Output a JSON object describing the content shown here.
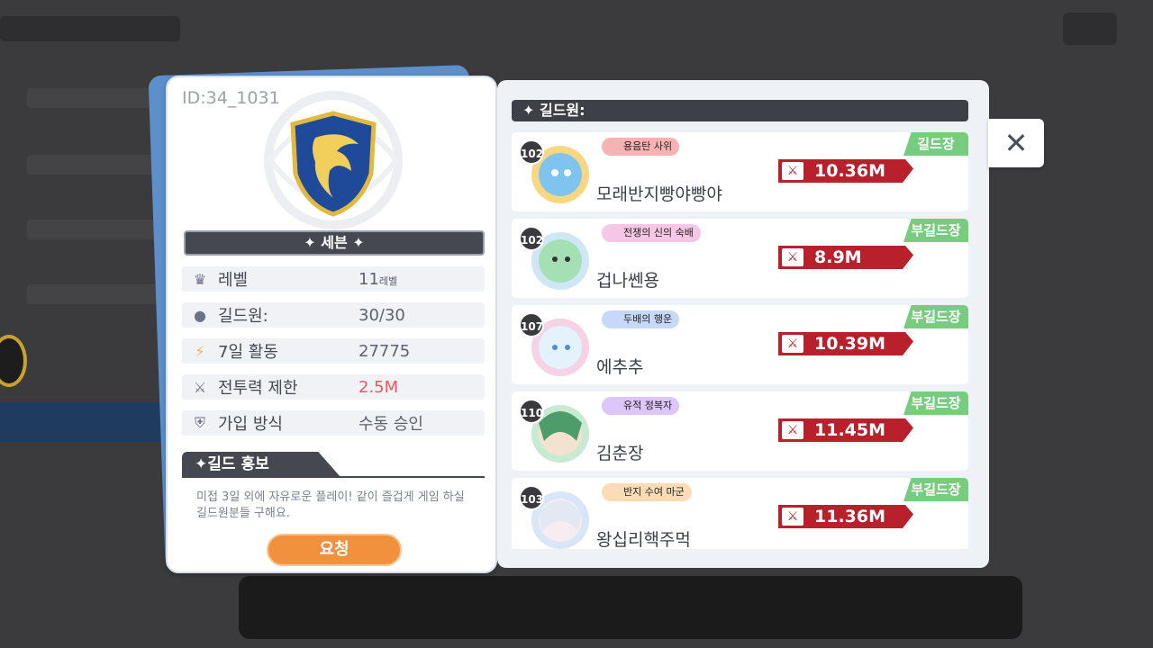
{
  "guild": {
    "id_label": "ID:34_1031",
    "name": "세븐",
    "emblem_icon": "eagle-shield-icon",
    "info": [
      {
        "icon": "crown-icon",
        "label": "레벨",
        "value": "11",
        "unit": "레벨"
      },
      {
        "icon": "person-icon",
        "label": "길드원:",
        "value": "30/30",
        "unit": ""
      },
      {
        "icon": "lightning-icon",
        "label": "7일 활동",
        "value": "27775",
        "unit": ""
      },
      {
        "icon": "crossed-swords-icon",
        "label": "전투력 제한",
        "value": "2.5M",
        "unit": ""
      },
      {
        "icon": "shield-icon",
        "label": "가입 방식",
        "value": "수동 승인",
        "unit": ""
      }
    ],
    "promo_title": "✦길드 홍보",
    "promo_text": "미접 3일 외에 자유로운 플레이! 같이 즐겁게 게임 하실 길드원분들 구해요.",
    "request_button": "요청"
  },
  "members_header": "✦ 길드원:",
  "members": [
    {
      "level": "102",
      "title": "용음탄 사위",
      "title_color": "#f7b3b3",
      "name": "모래반지빵야빵야",
      "power": "10.36M",
      "role": "길드장"
    },
    {
      "level": "102",
      "title": "전쟁의 신의 숙배",
      "title_color": "#f6c6e6",
      "name": "겁나쎈용",
      "power": "8.9M",
      "role": "부길드장"
    },
    {
      "level": "107",
      "title": "두배의 행운",
      "title_color": "#c7d8fb",
      "name": "에추추",
      "power": "10.39M",
      "role": "부길드장"
    },
    {
      "level": "110",
      "title": "유적 정복자",
      "title_color": "#dcc6fb",
      "name": "김춘장",
      "power": "11.45M",
      "role": "부길드장"
    },
    {
      "level": "103",
      "title": "반지 수여 마군",
      "title_color": "#fbdcb6",
      "name": "왕십리핵주먹",
      "power": "11.36M",
      "role": "부길드장"
    }
  ],
  "colors": {
    "accent_orange": "#f1913d",
    "role_green": "#77cc7f",
    "power_red": "#b8202b",
    "panel_dark": "#46484f"
  },
  "close_icon": "close-icon"
}
